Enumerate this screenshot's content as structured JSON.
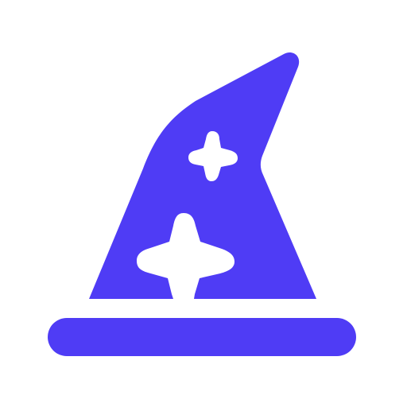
{
  "icon": {
    "name": "wizard-hat-icon",
    "color": "#4F3CF5",
    "background": "#FFFFFF",
    "sparkles": [
      {
        "name": "sparkle-small-icon"
      },
      {
        "name": "sparkle-large-icon"
      }
    ]
  }
}
